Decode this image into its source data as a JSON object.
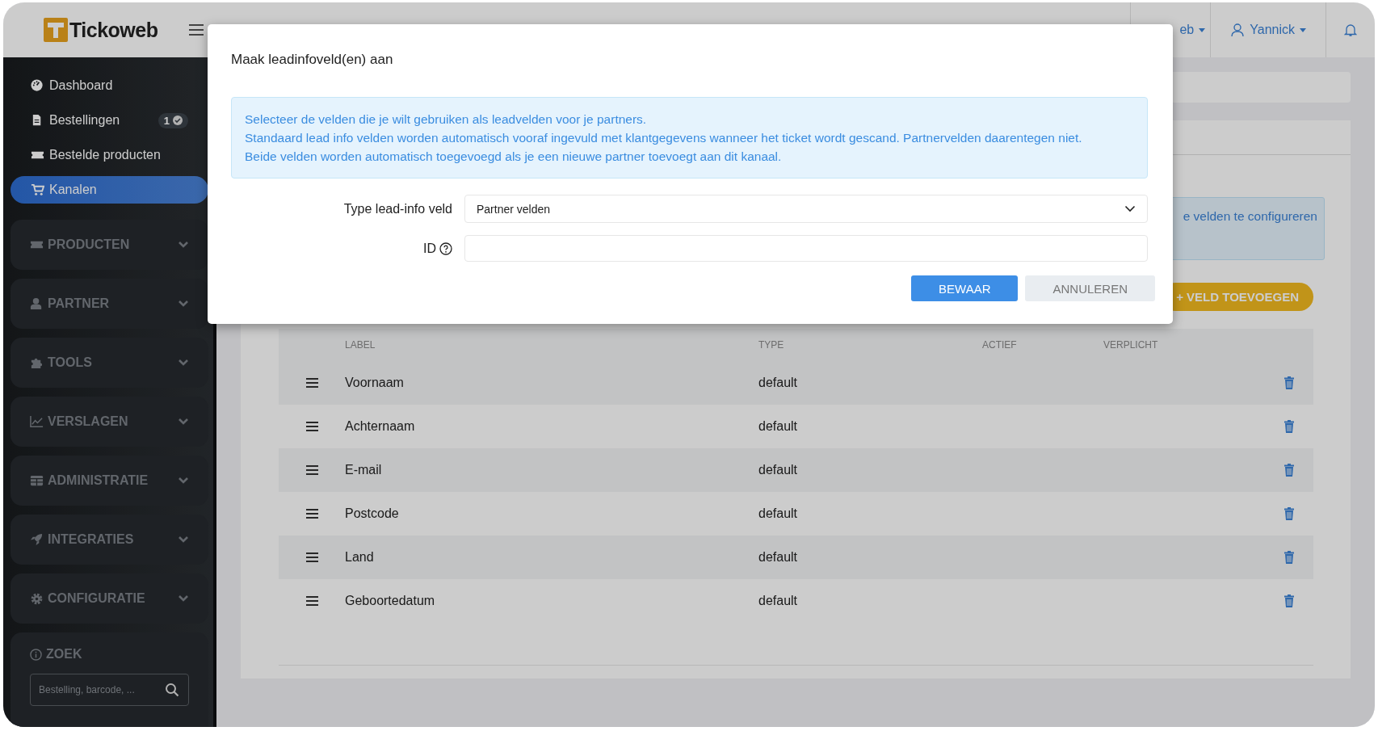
{
  "header": {
    "logo": "Tickoweb",
    "channel_menu": "eb",
    "user_menu": "Yannick"
  },
  "sidebar": {
    "items": [
      {
        "label": "Dashboard",
        "selected": false
      },
      {
        "label": "Bestellingen",
        "badge": "1",
        "selected": false
      },
      {
        "label": "Bestelde producten",
        "selected": false
      },
      {
        "label": "Kanalen",
        "selected": true
      }
    ],
    "sections": [
      {
        "label": "PRODUCTEN",
        "expanded": false
      },
      {
        "label": "PARTNER",
        "expanded": false
      },
      {
        "label": "TOOLS",
        "expanded": false
      },
      {
        "label": "VERSLAGEN",
        "expanded": false
      },
      {
        "label": "ADMINISTRATIE",
        "expanded": false
      },
      {
        "label": "INTEGRATIES",
        "expanded": false
      },
      {
        "label": "CONFIGURATIE",
        "expanded": false
      }
    ],
    "search": {
      "title": "ZOEK",
      "placeholder": "Bestelling, barcode, ..."
    }
  },
  "page": {
    "info_text": "e velden te configureren",
    "add_button": "+ VELD TOEVOEGEN",
    "table": {
      "columns": [
        "LABEL",
        "TYPE",
        "ACTIEF",
        "VERPLICHT"
      ],
      "rows": [
        {
          "label": "Voornaam",
          "type": "default"
        },
        {
          "label": "Achternaam",
          "type": "default"
        },
        {
          "label": "E-mail",
          "type": "default"
        },
        {
          "label": "Postcode",
          "type": "default"
        },
        {
          "label": "Land",
          "type": "default"
        },
        {
          "label": "Geboortedatum",
          "type": "default"
        }
      ]
    }
  },
  "modal": {
    "title": "Maak leadinfoveld(en) aan",
    "info_lines": [
      "Selecteer de velden die je wilt gebruiken als leadvelden voor je partners.",
      "Standaard lead info velden worden automatisch vooraf ingevuld met klantgegevens wanneer het ticket wordt gescand. Partnervelden daarentegen niet.",
      "Beide velden worden automatisch toegevoegd als je een nieuwe partner toevoegt aan dit kanaal."
    ],
    "fields": [
      {
        "kind": "select",
        "label": "Type lead-info veld",
        "value": "Partner velden"
      },
      {
        "kind": "text",
        "label": "ID",
        "help": true
      }
    ],
    "buttons": [
      {
        "label": "BEWAAR",
        "kind": "primary"
      },
      {
        "label": "ANNULEREN",
        "kind": "secondary"
      }
    ]
  }
}
